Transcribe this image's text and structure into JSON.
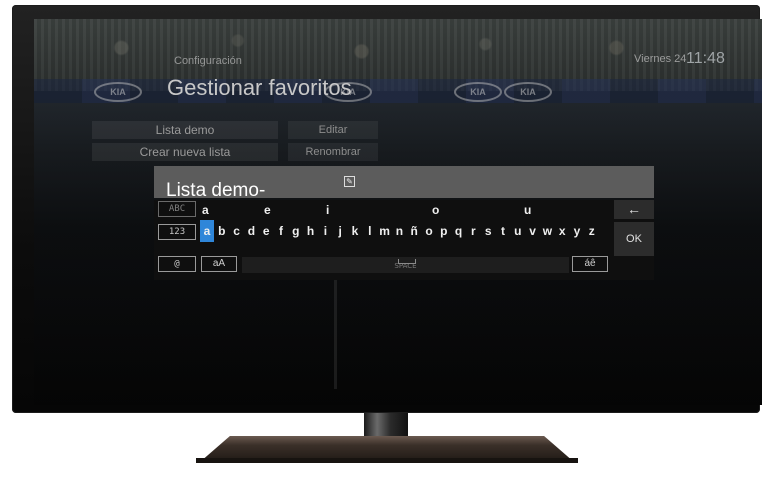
{
  "header": {
    "breadcrumb": "Configuración",
    "title": "Gestionar favoritos",
    "day": "Viernes 24",
    "time": "11:48"
  },
  "background": {
    "ad_text": "KIA"
  },
  "list_menu": {
    "items": [
      "Lista demo",
      "Crear nueva lista"
    ]
  },
  "actions": {
    "items": [
      "Editar",
      "Renombrar"
    ]
  },
  "keyboard": {
    "input_value": "Lista demo-",
    "mode_abc": "ABC",
    "mode_123": "123",
    "mode_symbols": "@",
    "case_toggle": "aA",
    "accent_toggle": "áê",
    "space_label": "SPACE",
    "ok_label": "OK",
    "backspace_label": "←",
    "vowels": [
      "a",
      "e",
      "i",
      "o",
      "u"
    ],
    "letters": [
      "a",
      "b",
      "c",
      "d",
      "e",
      "f",
      "g",
      "h",
      "i",
      "j",
      "k",
      "l",
      "m",
      "n",
      "ñ",
      "o",
      "p",
      "q",
      "r",
      "s",
      "t",
      "u",
      "v",
      "w",
      "x",
      "y",
      "z"
    ],
    "selected_key": "a"
  },
  "colors": {
    "selection": "#2f86d9",
    "input_bg": "#5c5c5c",
    "keyboard_bg": "#0f0f0f"
  }
}
